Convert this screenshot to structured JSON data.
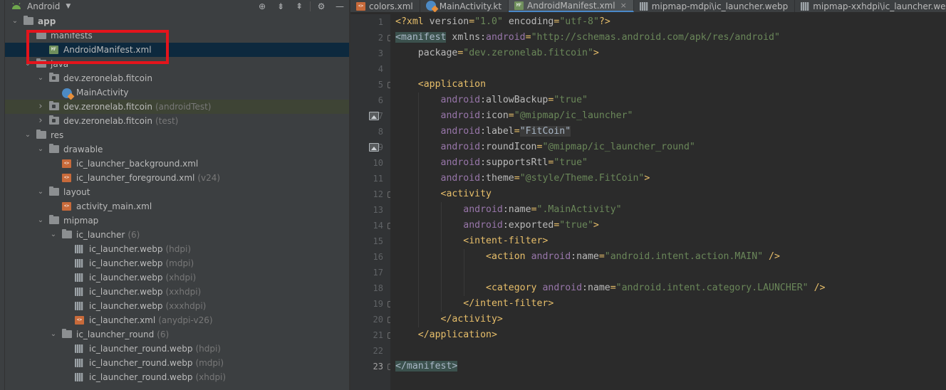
{
  "project_panel": {
    "view_mode": "Android",
    "tree": [
      {
        "label": "app",
        "hint": "",
        "depth": 0,
        "expanded": true,
        "icon": "module-folder-icon",
        "bold": true
      },
      {
        "label": "manifests",
        "hint": "",
        "depth": 1,
        "expanded": true,
        "icon": "folder-icon"
      },
      {
        "label": "AndroidManifest.xml",
        "hint": "",
        "depth": 2,
        "icon": "manifest-file-icon",
        "selected": true
      },
      {
        "label": "java",
        "hint": "",
        "depth": 1,
        "expanded": true,
        "icon": "folder-icon"
      },
      {
        "label": "dev.zeronelab.fitcoin",
        "hint": "",
        "depth": 2,
        "expanded": true,
        "icon": "package-icon"
      },
      {
        "label": "MainActivity",
        "hint": "",
        "depth": 3,
        "icon": "kotlin-class-icon"
      },
      {
        "label": "dev.zeronelab.fitcoin",
        "hint": "(androidTest)",
        "depth": 2,
        "expanded": false,
        "icon": "package-icon",
        "green": true
      },
      {
        "label": "dev.zeronelab.fitcoin",
        "hint": "(test)",
        "depth": 2,
        "expanded": false,
        "icon": "package-icon"
      },
      {
        "label": "res",
        "hint": "",
        "depth": 1,
        "expanded": true,
        "icon": "folder-icon"
      },
      {
        "label": "drawable",
        "hint": "",
        "depth": 2,
        "expanded": true,
        "icon": "folder-icon"
      },
      {
        "label": "ic_launcher_background.xml",
        "hint": "",
        "depth": 3,
        "icon": "xml-file-icon"
      },
      {
        "label": "ic_launcher_foreground.xml",
        "hint": "(v24)",
        "depth": 3,
        "icon": "xml-file-icon"
      },
      {
        "label": "layout",
        "hint": "",
        "depth": 2,
        "expanded": true,
        "icon": "folder-icon"
      },
      {
        "label": "activity_main.xml",
        "hint": "",
        "depth": 3,
        "icon": "xml-file-icon"
      },
      {
        "label": "mipmap",
        "hint": "",
        "depth": 2,
        "expanded": true,
        "icon": "folder-icon"
      },
      {
        "label": "ic_launcher",
        "hint": "(6)",
        "depth": 3,
        "expanded": true,
        "icon": "folder-icon"
      },
      {
        "label": "ic_launcher.webp",
        "hint": "(hdpi)",
        "depth": 4,
        "icon": "image-file-icon"
      },
      {
        "label": "ic_launcher.webp",
        "hint": "(mdpi)",
        "depth": 4,
        "icon": "image-file-icon"
      },
      {
        "label": "ic_launcher.webp",
        "hint": "(xhdpi)",
        "depth": 4,
        "icon": "image-file-icon"
      },
      {
        "label": "ic_launcher.webp",
        "hint": "(xxhdpi)",
        "depth": 4,
        "icon": "image-file-icon"
      },
      {
        "label": "ic_launcher.webp",
        "hint": "(xxxhdpi)",
        "depth": 4,
        "icon": "image-file-icon"
      },
      {
        "label": "ic_launcher.xml",
        "hint": "(anydpi-v26)",
        "depth": 4,
        "icon": "xml-file-icon"
      },
      {
        "label": "ic_launcher_round",
        "hint": "(6)",
        "depth": 3,
        "expanded": true,
        "icon": "folder-icon"
      },
      {
        "label": "ic_launcher_round.webp",
        "hint": "(hdpi)",
        "depth": 4,
        "icon": "image-file-icon"
      },
      {
        "label": "ic_launcher_round.webp",
        "hint": "(mdpi)",
        "depth": 4,
        "icon": "image-file-icon"
      },
      {
        "label": "ic_launcher_round.webp",
        "hint": "(xhdpi)",
        "depth": 4,
        "icon": "image-file-icon"
      }
    ]
  },
  "editor": {
    "tabs": [
      {
        "label": "colors.xml",
        "icon": "xml-file-icon",
        "active": false
      },
      {
        "label": "MainActivity.kt",
        "icon": "kotlin-class-icon",
        "active": false
      },
      {
        "label": "AndroidManifest.xml",
        "icon": "manifest-file-icon",
        "active": true,
        "closable": true
      },
      {
        "label": "mipmap-mdpi\\ic_launcher.webp",
        "icon": "image-file-icon",
        "active": false
      },
      {
        "label": "mipmap-xxhdpi\\ic_launcher.webp",
        "icon": "image-file-icon",
        "active": false
      }
    ],
    "current_line": 23,
    "gutter_image_lines": [
      7,
      9
    ],
    "fold_lines": [
      2,
      5,
      12,
      14,
      19,
      20,
      21,
      23
    ],
    "lines": [
      [
        [
          "punct",
          "<?"
        ],
        [
          "tag",
          "xml "
        ],
        [
          "attr",
          "version"
        ],
        [
          "punct",
          "="
        ],
        [
          "val",
          "\"1.0\" "
        ],
        [
          "attr",
          "encoding"
        ],
        [
          "punct",
          "="
        ],
        [
          "val",
          "\"utf-8\""
        ],
        [
          "punct",
          "?>"
        ]
      ],
      [
        [
          "tag-hl",
          "<manifest"
        ],
        [
          "attr",
          " xmlns:"
        ],
        [
          "ns",
          "android"
        ],
        [
          "punct",
          "="
        ],
        [
          "val",
          "\"http://schemas.android.com/apk/res/android\""
        ]
      ],
      [
        [
          "attr",
          "    package"
        ],
        [
          "punct",
          "="
        ],
        [
          "val",
          "\"dev.zeronelab.fitcoin\""
        ],
        [
          "tag",
          ">"
        ]
      ],
      [],
      [
        [
          "tag",
          "    <application"
        ]
      ],
      [
        [
          "ns",
          "        android"
        ],
        [
          "attr",
          ":allowBackup"
        ],
        [
          "punct",
          "="
        ],
        [
          "val",
          "\"true\""
        ]
      ],
      [
        [
          "ns",
          "        android"
        ],
        [
          "attr",
          ":icon"
        ],
        [
          "punct",
          "="
        ],
        [
          "val",
          "\"@mipmap/ic_launcher\""
        ]
      ],
      [
        [
          "ns",
          "        android"
        ],
        [
          "attr",
          ":label"
        ],
        [
          "punct",
          "="
        ],
        [
          "val-hl",
          "\"FitCoin\""
        ]
      ],
      [
        [
          "ns",
          "        android"
        ],
        [
          "attr",
          ":roundIcon"
        ],
        [
          "punct",
          "="
        ],
        [
          "val",
          "\"@mipmap/ic_launcher_round\""
        ]
      ],
      [
        [
          "ns",
          "        android"
        ],
        [
          "attr",
          ":supportsRtl"
        ],
        [
          "punct",
          "="
        ],
        [
          "val",
          "\"true\""
        ]
      ],
      [
        [
          "ns",
          "        android"
        ],
        [
          "attr",
          ":theme"
        ],
        [
          "punct",
          "="
        ],
        [
          "val",
          "\"@style/Theme.FitCoin\""
        ],
        [
          "tag",
          ">"
        ]
      ],
      [
        [
          "tag",
          "        <activity"
        ]
      ],
      [
        [
          "ns",
          "            android"
        ],
        [
          "attr",
          ":name"
        ],
        [
          "punct",
          "="
        ],
        [
          "val",
          "\".MainActivity\""
        ]
      ],
      [
        [
          "ns",
          "            android"
        ],
        [
          "attr",
          ":exported"
        ],
        [
          "punct",
          "="
        ],
        [
          "val",
          "\"true\""
        ],
        [
          "tag",
          ">"
        ]
      ],
      [
        [
          "tag",
          "            <intent-filter>"
        ]
      ],
      [
        [
          "tag",
          "                <action "
        ],
        [
          "ns",
          "android"
        ],
        [
          "attr",
          ":name"
        ],
        [
          "punct",
          "="
        ],
        [
          "val",
          "\"android.intent.action.MAIN\" "
        ],
        [
          "tag",
          "/>"
        ]
      ],
      [],
      [
        [
          "tag",
          "                <category "
        ],
        [
          "ns",
          "android"
        ],
        [
          "attr",
          ":name"
        ],
        [
          "punct",
          "="
        ],
        [
          "val",
          "\"android.intent.category.LAUNCHER\" "
        ],
        [
          "tag",
          "/>"
        ]
      ],
      [
        [
          "tag",
          "            </intent-filter>"
        ]
      ],
      [
        [
          "tag",
          "        </activity>"
        ]
      ],
      [
        [
          "tag",
          "    </application>"
        ]
      ],
      [],
      [
        [
          "tag-hl",
          "</manifest>"
        ]
      ]
    ]
  },
  "colors": {
    "background": "#2b2b2b",
    "panel": "#3c3f41",
    "selection": "#0d293e",
    "highlight_box": "#e4141c",
    "tag": "#e8bf6a",
    "attribute_value": "#6a8759",
    "namespace": "#9876aa"
  }
}
